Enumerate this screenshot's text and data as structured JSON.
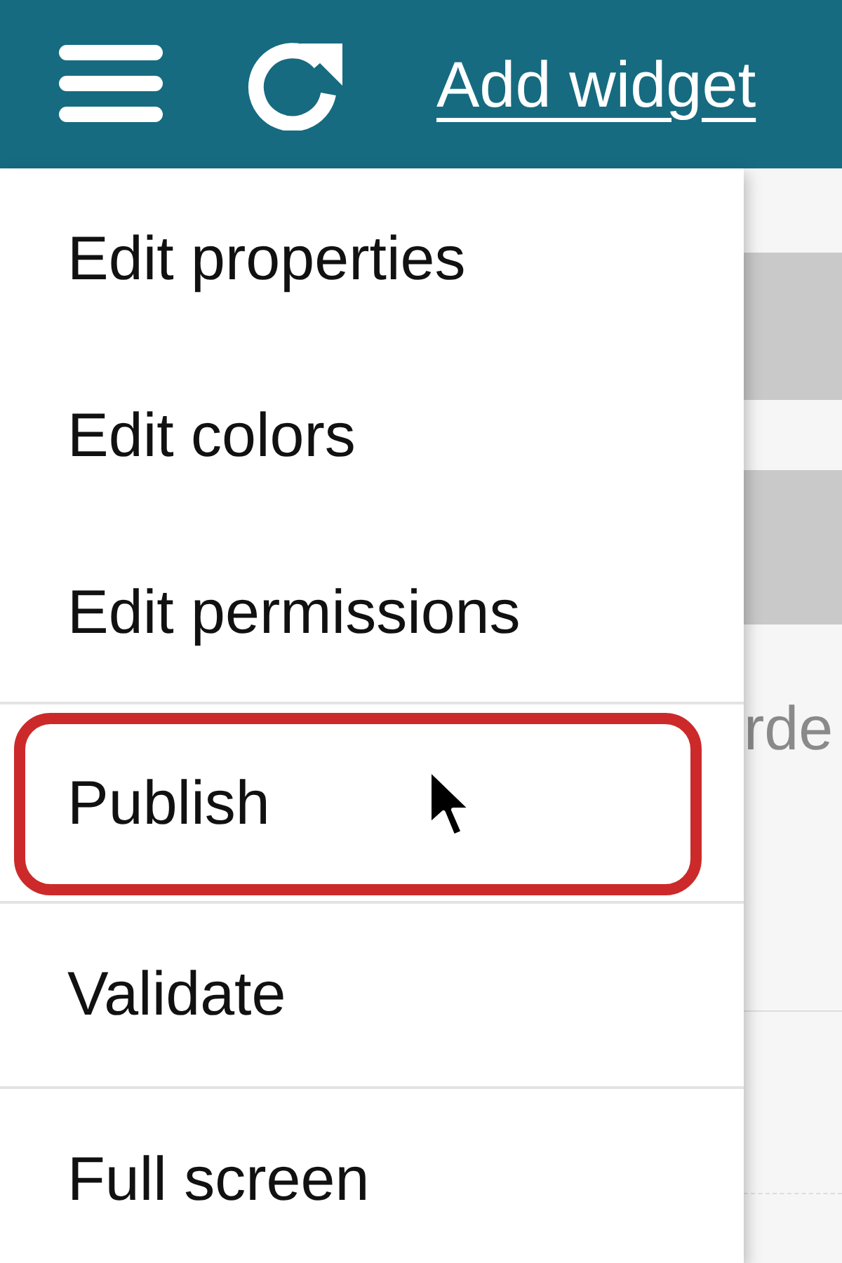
{
  "toolbar": {
    "add_widget": "Add widget"
  },
  "background": {
    "partial_text": "rde"
  },
  "menu": {
    "sections": [
      {
        "items": [
          {
            "label": "Edit properties",
            "highlighted": false
          },
          {
            "label": "Edit colors",
            "highlighted": false
          },
          {
            "label": "Edit permissions",
            "highlighted": false
          }
        ]
      },
      {
        "items": [
          {
            "label": "Publish",
            "highlighted": true
          }
        ]
      },
      {
        "items": [
          {
            "label": "Validate",
            "highlighted": false
          }
        ]
      },
      {
        "items": [
          {
            "label": "Full screen",
            "highlighted": false
          }
        ]
      }
    ]
  }
}
